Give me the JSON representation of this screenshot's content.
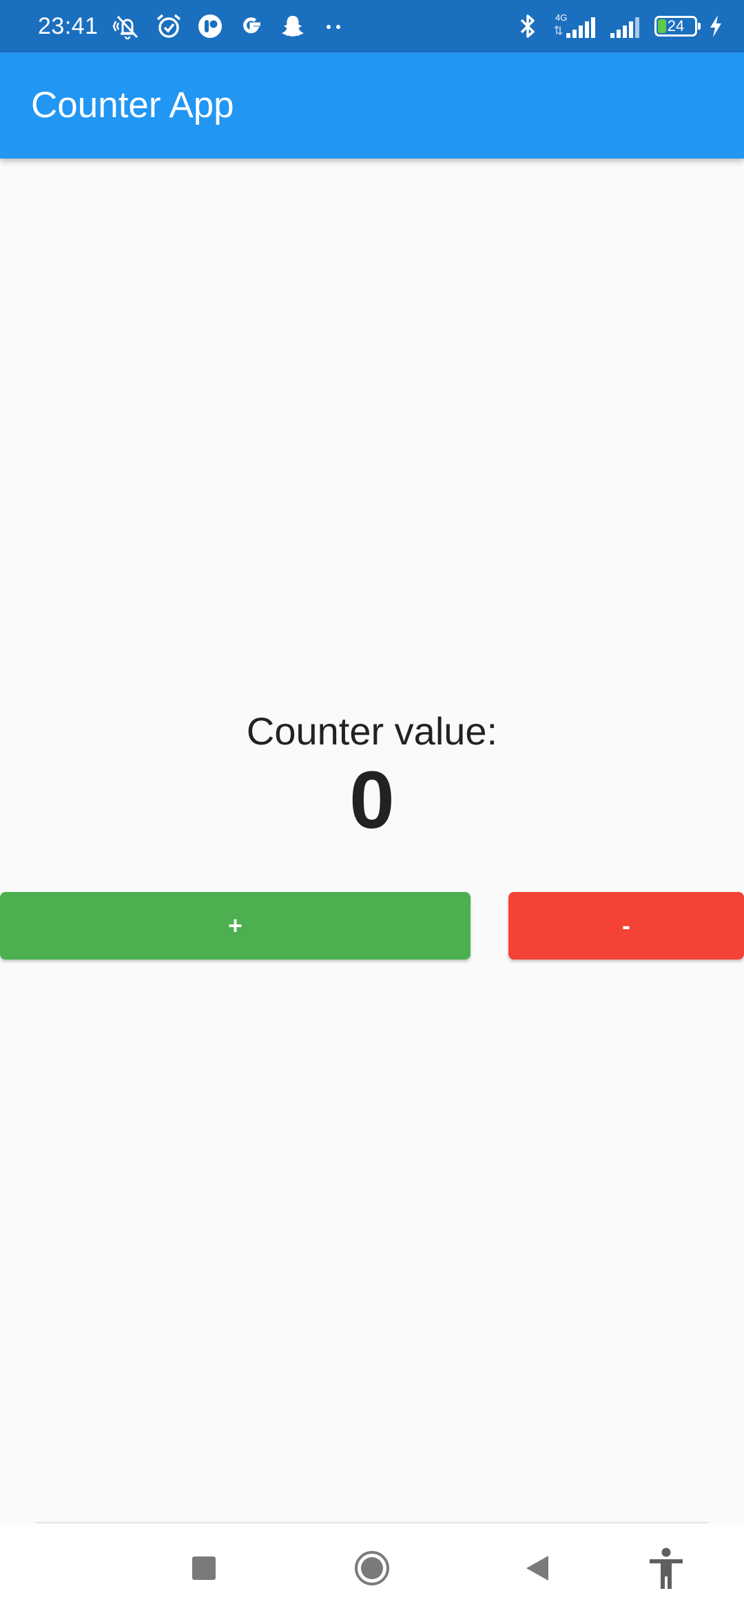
{
  "status_bar": {
    "time": "23:41",
    "battery_level": "24",
    "battery_fraction": 0.24,
    "background_color": "#1b6fbf",
    "left_icons": [
      "vibrate-off-icon",
      "alarm-icon",
      "app-notification-icon",
      "google-icon",
      "snapchat-icon",
      "more-notifications-icon"
    ],
    "right_icons": [
      "bluetooth-icon",
      "mobile-signal-4g-icon",
      "signal-icon",
      "battery-icon",
      "charging-icon"
    ],
    "network_type": "4G"
  },
  "app_bar": {
    "title": "Counter App",
    "color": "#2196f3"
  },
  "counter": {
    "label": "Counter value:",
    "value": "0"
  },
  "buttons": {
    "increment_label": "+",
    "increment_color": "#4caf50",
    "decrement_label": "-",
    "decrement_color": "#f44336"
  },
  "navigation_bar": {
    "items": [
      "recents-square-icon",
      "home-circle-icon",
      "back-triangle-icon",
      "accessibility-icon"
    ]
  }
}
